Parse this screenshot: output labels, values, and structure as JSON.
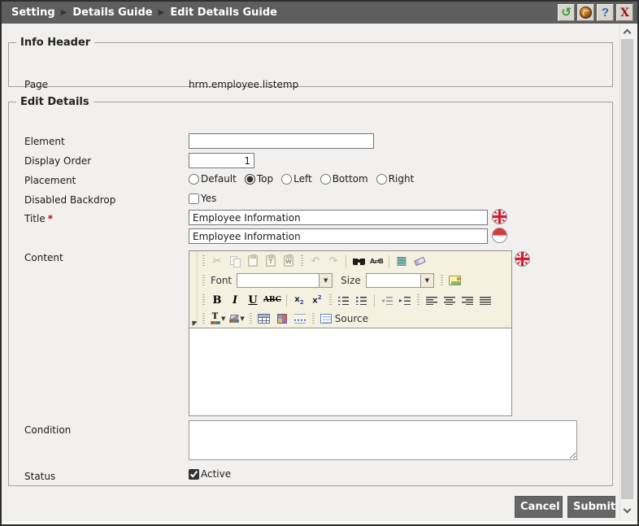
{
  "titlebar": {
    "breadcrumb": [
      "Setting",
      "Details Guide",
      "Edit Details Guide"
    ],
    "separator": "▶",
    "refresh_glyph": "↺",
    "help_glyph": "?",
    "close_glyph": "X",
    "icons": [
      "refresh-icon",
      "support-icon",
      "help-icon",
      "close-icon"
    ]
  },
  "info_header": {
    "legend": "Info Header",
    "page_label": "Page",
    "page_value": "hrm.employee.listemp"
  },
  "edit_details": {
    "legend": "Edit Details",
    "element_label": "Element",
    "element_value": "",
    "display_order_label": "Display Order",
    "display_order_value": "1",
    "placement_label": "Placement",
    "placement_options": [
      "Default",
      "Top",
      "Left",
      "Bottom",
      "Right"
    ],
    "placement_selected": "Top",
    "disabled_backdrop_label": "Disabled Backdrop",
    "disabled_backdrop_option": "Yes",
    "disabled_backdrop_checked": false,
    "title_label": "Title",
    "required_marker": "*",
    "title_value_primary": "Employee Information",
    "title_value_secondary": "Employee Information",
    "title_lang_primary": "english-flag",
    "title_lang_secondary": "indonesian-flag",
    "content_label": "Content",
    "content_value": "",
    "condition_label": "Condition",
    "condition_value": "",
    "status_label": "Status",
    "status_option": "Active",
    "status_checked": true
  },
  "editor": {
    "font_label": "Font",
    "font_value": "",
    "size_label": "Size",
    "size_value": "",
    "bold_label": "B",
    "italic_label": "I",
    "underline_label": "U",
    "strike_label": "ABC",
    "sub_base": "x",
    "sub_script": "2",
    "sup_base": "x",
    "sup_script": "2",
    "cut_glyph": "✂",
    "undo_glyph": "↶",
    "redo_glyph": "↷",
    "replace_glyph": "A⇄B",
    "selectall_glyph": "▦",
    "paste_plain_letter": "",
    "paste_text_letter": "T",
    "paste_word_letter": "W",
    "source_label": "Source"
  },
  "footer": {
    "cancel_label": "Cancel",
    "submit_label": "Submit"
  },
  "colors": {
    "titlebar": "#5e5e5e",
    "toolbar_bg": "#f4f1e1",
    "button": "#666666",
    "required": "#d40000",
    "refresh_green": "#3f9e3f",
    "help_blue": "#2c6cc4",
    "close_red": "#9e1515"
  }
}
